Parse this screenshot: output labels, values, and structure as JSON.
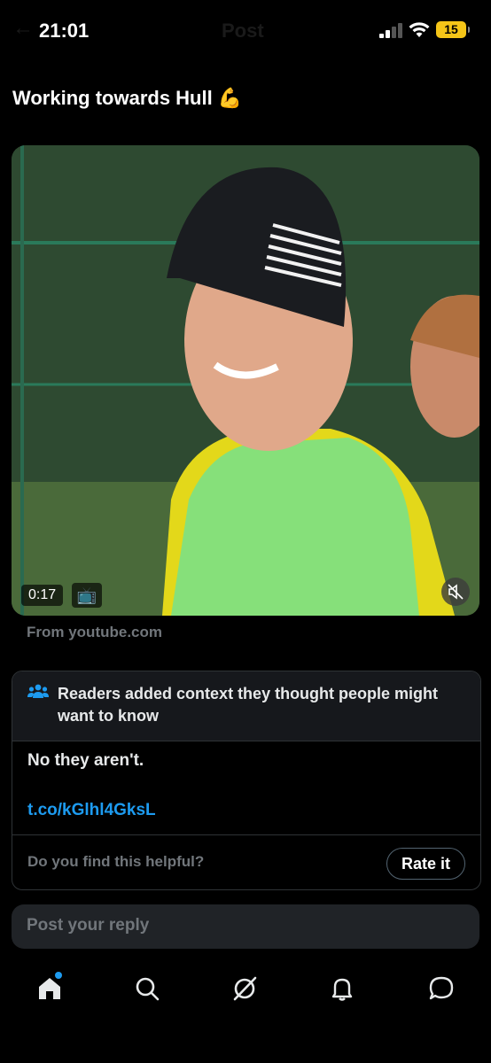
{
  "status_bar": {
    "time": "21:01",
    "battery": "15",
    "screen_title": "Post",
    "back_icon": "back-arrow-icon"
  },
  "post": {
    "text": "Working towards Hull 💪"
  },
  "media": {
    "duration": "0:17",
    "badge_icon": "tv-icon",
    "mute_icon": "muted-speaker-icon",
    "source": "From youtube.com"
  },
  "community_note": {
    "icon": "people-icon",
    "title": "Readers added context they thought people might want to know",
    "body": "No they aren't.",
    "link": "t.co/kGlhl4GksL",
    "helpful_prompt": "Do you find this helpful?",
    "rate_label": "Rate it"
  },
  "reply": {
    "placeholder": "Post your reply"
  },
  "tabs": [
    {
      "name": "home",
      "icon": "home-icon"
    },
    {
      "name": "search",
      "icon": "search-icon"
    },
    {
      "name": "grok",
      "icon": "grok-icon"
    },
    {
      "name": "notifications",
      "icon": "bell-icon"
    },
    {
      "name": "messages",
      "icon": "chat-icon"
    }
  ],
  "colors": {
    "accent": "#1d9bf0",
    "background": "#000000",
    "battery": "#f5c518"
  }
}
